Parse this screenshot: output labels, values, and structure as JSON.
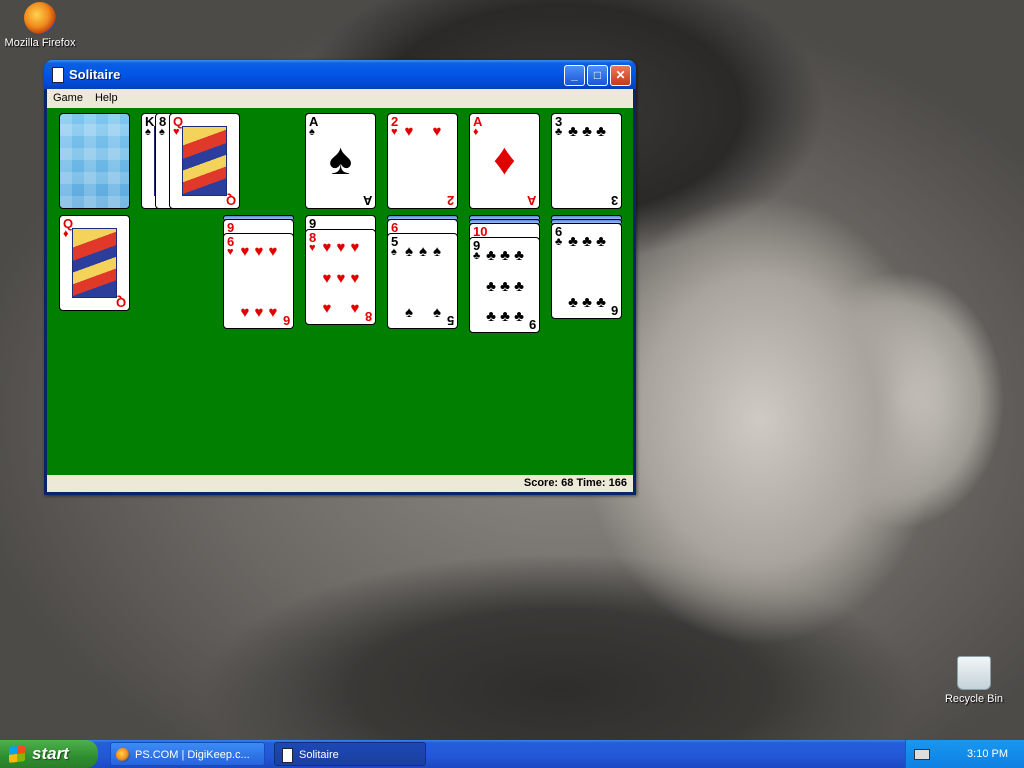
{
  "desktop": {
    "icons": [
      {
        "label": "Mozilla Firefox"
      },
      {
        "label": "Recycle Bin"
      }
    ]
  },
  "window": {
    "title": "Solitaire",
    "menu": [
      "Game",
      "Help"
    ],
    "status": "Score: 68 Time: 166"
  },
  "game": {
    "stock": {
      "type": "back"
    },
    "waste": [
      {
        "rank": "K",
        "suit": "♠",
        "color": "black"
      },
      {
        "rank": "8",
        "suit": "♠",
        "color": "black"
      },
      {
        "rank": "Q",
        "suit": "♥",
        "color": "red"
      }
    ],
    "foundations": [
      {
        "rank": "A",
        "suit": "♠",
        "color": "black"
      },
      {
        "rank": "2",
        "suit": "♥",
        "color": "red"
      },
      {
        "rank": "A",
        "suit": "♦",
        "color": "red"
      },
      {
        "rank": "3",
        "suit": "♣",
        "color": "black"
      }
    ],
    "tableau": [
      {
        "cards": [
          {
            "rank": "Q",
            "suit": "♦",
            "color": "red"
          }
        ]
      },
      {
        "cards": []
      },
      {
        "hidden": 1,
        "cards": [
          {
            "rank": "9",
            "suit": "♥",
            "color": "red"
          },
          {
            "rank": "6",
            "suit": "♥",
            "color": "red"
          }
        ]
      },
      {
        "cards": [
          {
            "rank": "9",
            "suit": "♠",
            "color": "black"
          },
          {
            "rank": "8",
            "suit": "♥",
            "color": "red"
          }
        ]
      },
      {
        "hidden": 1,
        "cards": [
          {
            "rank": "6",
            "suit": "♥",
            "color": "red"
          },
          {
            "rank": "5",
            "suit": "♠",
            "color": "black"
          }
        ]
      },
      {
        "hidden": 2,
        "cards": [
          {
            "rank": "10",
            "suit": "♥",
            "color": "red"
          },
          {
            "rank": "9",
            "suit": "♣",
            "color": "black"
          }
        ]
      },
      {
        "hidden": 2,
        "cards": [
          {
            "rank": "6",
            "suit": "♣",
            "color": "black"
          }
        ]
      }
    ]
  },
  "taskbar": {
    "start_label": "start",
    "tasks": [
      "PS.COM | DigiKeep.c...",
      "Solitaire"
    ],
    "clock": "3:10 PM"
  }
}
